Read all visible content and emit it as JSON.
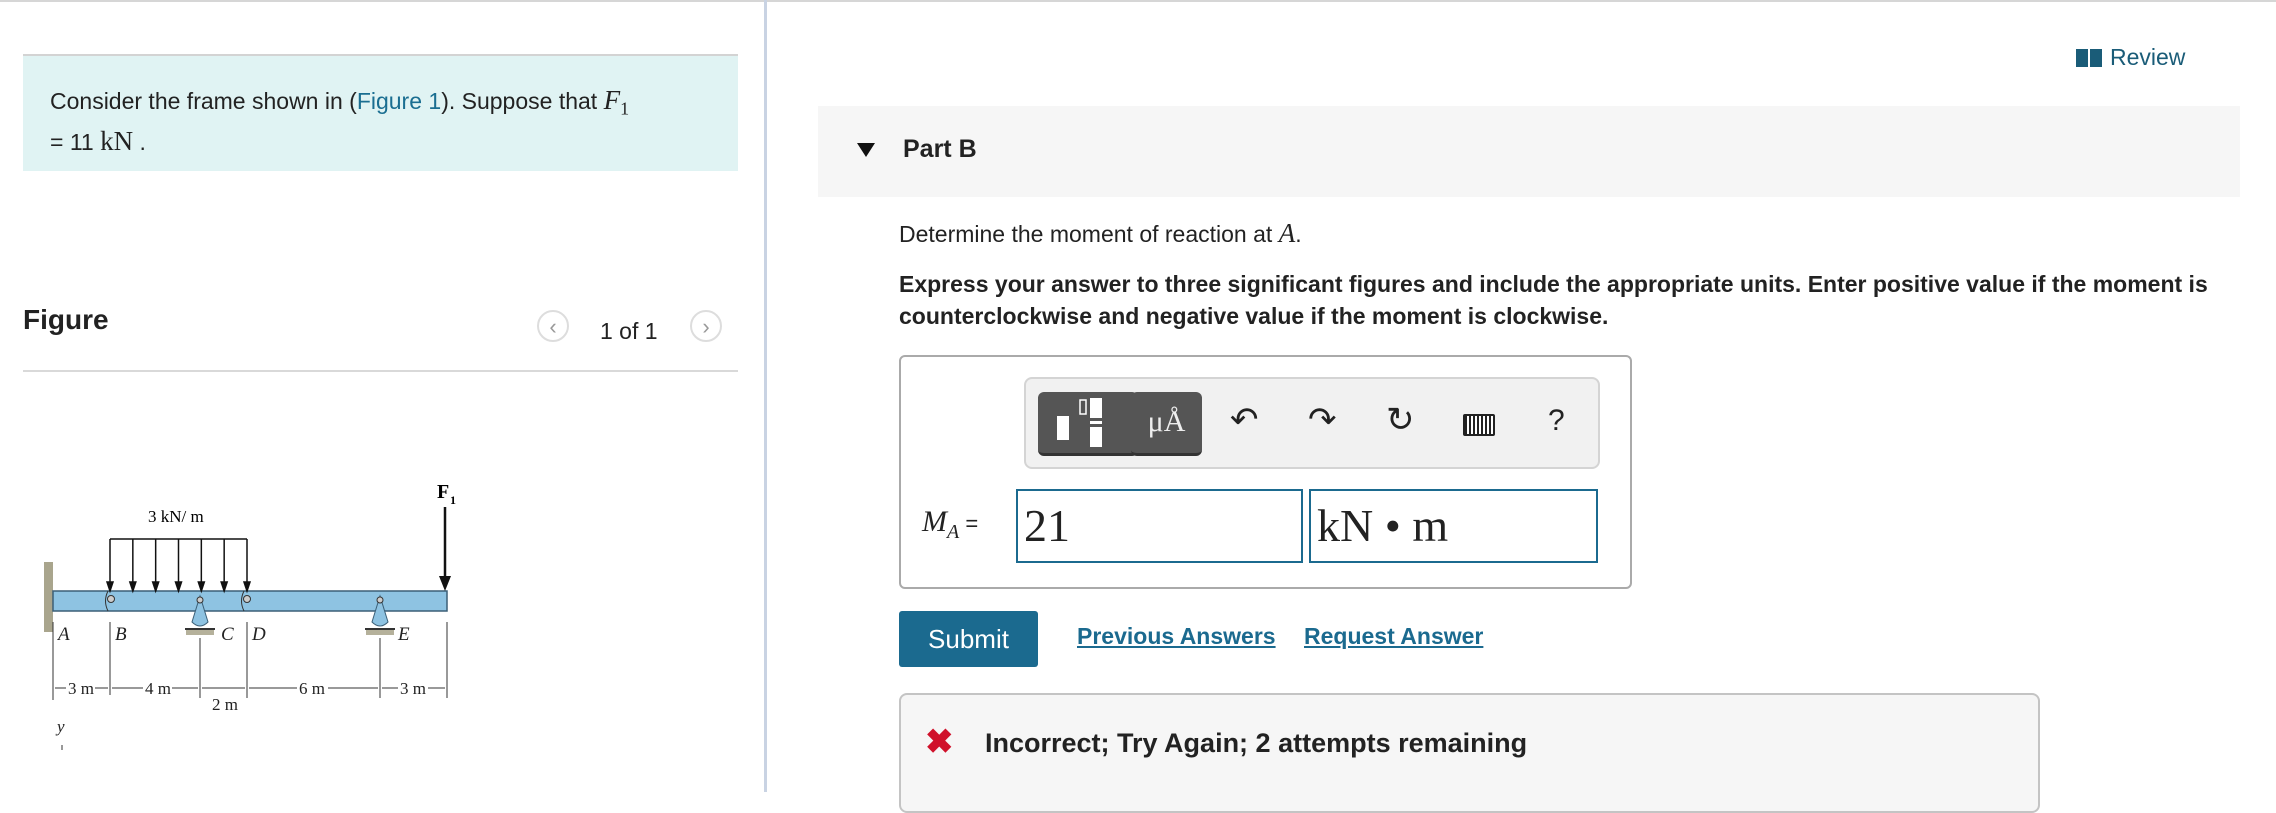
{
  "problem": {
    "text_before": "Consider the frame shown in (",
    "figure_link": "Figure 1",
    "text_after": "). Suppose that ",
    "var": "F",
    "var_sub": "1",
    "line2_prefix": "= 11 ",
    "line2_unit": "kN",
    "line2_suffix": " ."
  },
  "figure": {
    "title": "Figure",
    "pager": "1 of 1",
    "prev_icon": "chevron-left-icon",
    "next_icon": "chevron-right-icon",
    "labels": {
      "load": "3 kN/ m",
      "force": "F",
      "force_sub": "1",
      "A": "A",
      "B": "B",
      "C": "C",
      "D": "D",
      "E": "E",
      "d1": "3 m",
      "d2": "4 m",
      "d3": "2 m",
      "d4": "6 m",
      "d5": "3 m",
      "axis": "y"
    }
  },
  "review": {
    "label": "Review",
    "icon": "book-icon"
  },
  "part": {
    "title": "Part B",
    "question_prefix": "Determine the moment of reaction at ",
    "question_var": "A",
    "question_suffix": ".",
    "instructions": "Express your answer to three significant figures and include the appropriate units. Enter positive value if the moment is counterclockwise and negative value if the moment is clockwise."
  },
  "toolbar": {
    "templates_icon": "templates-icon",
    "units_label": "μÅ",
    "undo_icon": "undo-icon",
    "redo_icon": "redo-icon",
    "reset_icon": "reset-icon",
    "keyboard_icon": "keyboard-icon",
    "help_label": "?"
  },
  "answer": {
    "label_var": "M",
    "label_sub": "A",
    "label_eq": " =",
    "value": "21",
    "units": "kN • m"
  },
  "actions": {
    "submit": "Submit",
    "previous_answers": "Previous Answers",
    "request_answer": "Request Answer"
  },
  "feedback": {
    "icon": "x-icon",
    "message": "Incorrect; Try Again; 2 attempts remaining",
    "color": "#d0112b"
  }
}
